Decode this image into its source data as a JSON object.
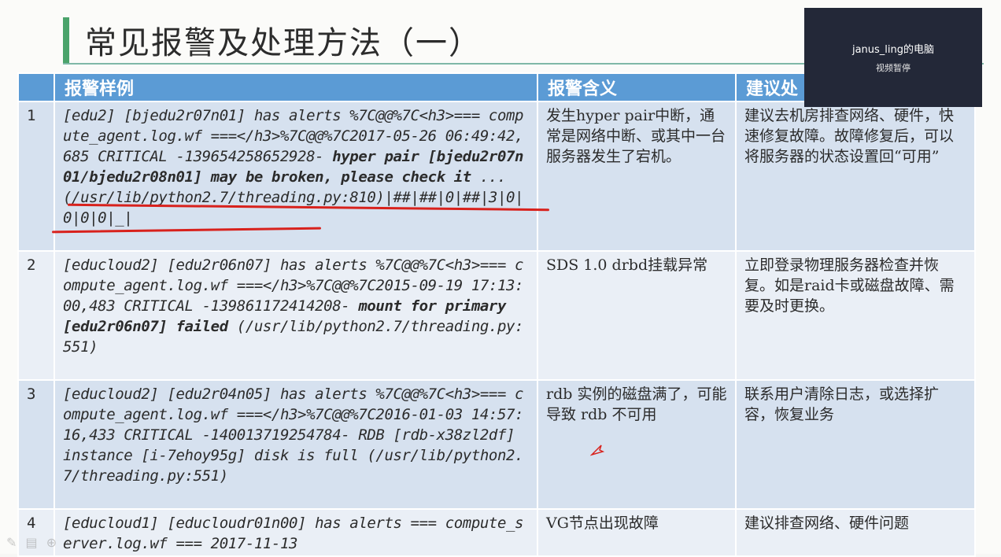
{
  "slide": {
    "title": "常见报警及处理方法（一）",
    "headers": [
      "",
      "报警样例",
      "报警含义",
      "建议处"
    ],
    "rows": [
      {
        "num": "1",
        "sample_pre": "[edu2] [bjedu2r07n01] has alerts %7C@@%7C<h3>=== compute_agent.log.wf ===</h3>%7C@@%7C2017-05-26 06:49:42,685 CRITICAL -139654258652928-",
        "sample_bold": " hyper pair [bjedu2r07n01/bjedu2r08n01] may be broken, please check it",
        "sample_post": " ... (/usr/lib/python2.7/threading.py:810)|##|##|0|##|3|0|0|0|0|_|",
        "meaning": "发生hyper pair中断，通常是网络中断、或其中一台服务器发生了宕机。",
        "advice": "建议去机房排查网络、硬件，快速修复故障。故障修复后，可以将服务器的状态设置回“可用”"
      },
      {
        "num": "2",
        "sample_pre": "[educloud2] [edu2r06n07] has alerts %7C@@%7C<h3>=== compute_agent.log.wf ===</h3>%7C@@%7C2015-09-19 17:13:00,483 CRITICAL -139861172414208-",
        "sample_bold": " mount for primary [edu2r06n07] failed",
        "sample_post": " (/usr/lib/python2.7/threading.py:551)",
        "meaning": "SDS 1.0 drbd挂载异常",
        "advice": "立即登录物理服务器检查并恢复。如是raid卡或磁盘故障、需要及时更换。"
      },
      {
        "num": "3",
        "sample_pre": "[educloud2] [edu2r04n05] has alerts %7C@@%7C<h3>=== compute_agent.log.wf ===</h3>%7C@@%7C2016-01-03 14:57:16,433 CRITICAL -140013719254784- RDB [rdb-x38zl2df] instance [i-7ehoy95g] disk is full (/usr/lib/python2.7/threading.py:551)",
        "sample_bold": "",
        "sample_post": "",
        "meaning": "rdb 实例的磁盘满了，可能导致 rdb 不可用",
        "advice": "联系用户清除日志，或选择扩容，恢复业务"
      },
      {
        "num": "4",
        "sample_pre": "[educloud1] [educloudr01n00] has alerts === compute_server.log.wf === 2017-11-13",
        "sample_bold": "",
        "sample_post": "",
        "meaning": "VG节点出现故障",
        "advice": "建议排查网络、硬件问题"
      }
    ]
  },
  "popup": {
    "name": "janus_ling的电脑",
    "status": "视频暂停"
  },
  "colors": {
    "header_bg": "#5b9bd5",
    "row_odd": "#d6e1ef",
    "row_even": "#eaeff6",
    "accent_green": "#4aa36b",
    "annotation_red": "#d8211c",
    "popup_bg": "#232838"
  }
}
